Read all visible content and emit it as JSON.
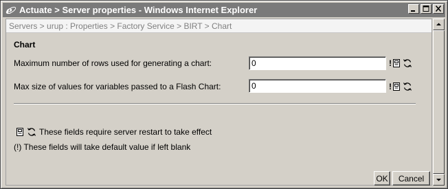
{
  "window": {
    "title": "Actuate > Server properties - Windows Internet Explorer"
  },
  "breadcrumb": "Servers > urup : Properties > Factory Service > BIRT > Chart",
  "section": {
    "title": "Chart"
  },
  "fields": [
    {
      "label": "Maximum number of rows used for generating a chart:",
      "value": "0",
      "flag": "!"
    },
    {
      "label": "Max size of values for variables passed to a Flash Chart:",
      "value": "0",
      "flag": "!"
    }
  ],
  "notes": {
    "restart": "These fields require server restart to take effect",
    "default": "(!) These fields will take default value if left blank"
  },
  "buttons": {
    "ok": "OK",
    "cancel": "Cancel"
  },
  "icons": {
    "title": "ie-icon",
    "restart": "server-restart-icon",
    "refresh": "refresh-icon"
  }
}
